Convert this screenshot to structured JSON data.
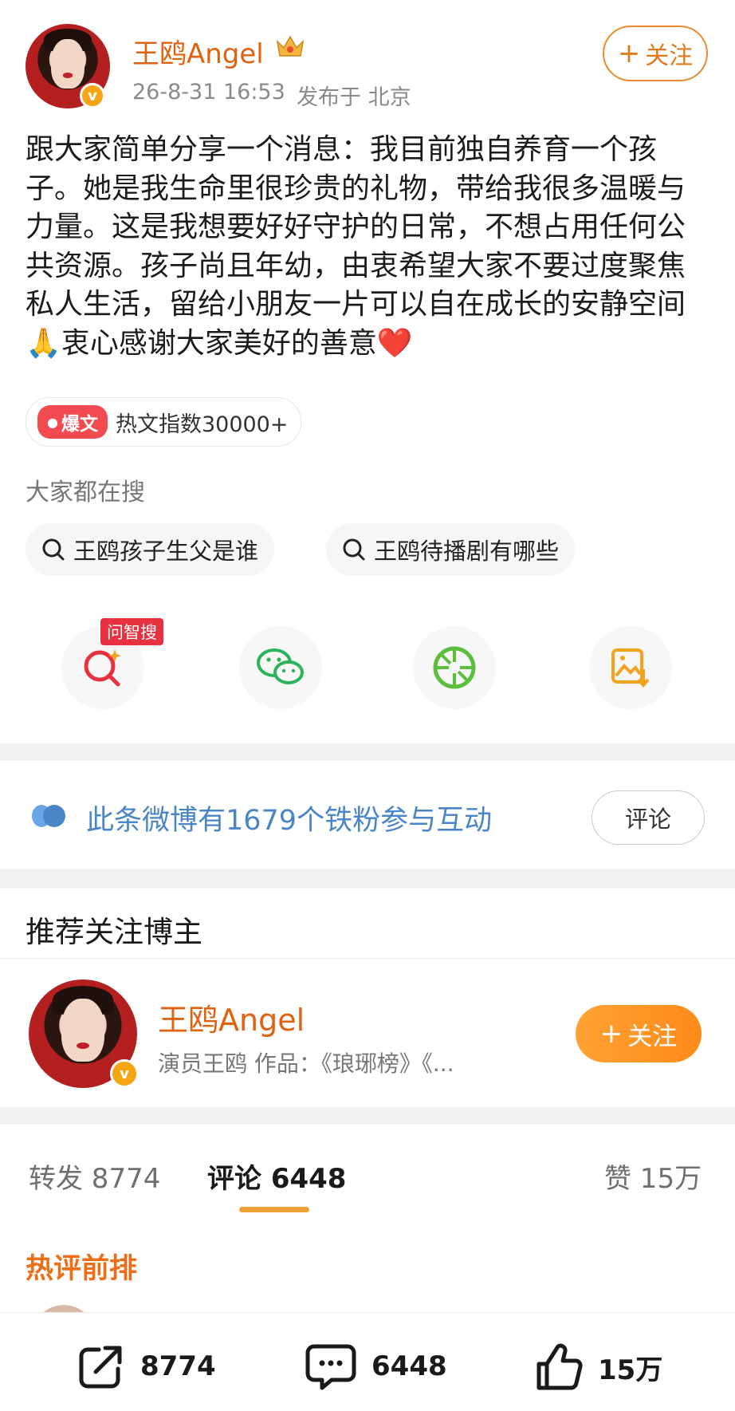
{
  "author": {
    "name": "王鸥Angel",
    "crown_icon": "crown-icon",
    "verified_icon": "verified-v-icon",
    "verified_mark": "v",
    "timestamp": "26-8-31 16:53",
    "location": "发布于 北京"
  },
  "header": {
    "follow_label": "关注",
    "follow_plus": "+"
  },
  "post": {
    "text": "跟大家简单分享一个消息：我目前独自养育一个孩子。她是我生命里很珍贵的礼物，带给我很多温暖与力量。这是我想要好好守护的日常，不想占用任何公共资源。孩子尚且年幼，由衷希望大家不要过度聚焦私人生活，留给小朋友一片可以自在成长的安静空间🙏衷心感谢大家美好的善意❤️"
  },
  "hot": {
    "badge_label": "爆文",
    "index_text": "热文指数30000+"
  },
  "searches": {
    "heading": "大家都在搜",
    "items": [
      {
        "label": "王鸥孩子生父是谁"
      },
      {
        "label": "王鸥待播剧有哪些"
      }
    ]
  },
  "share_actions": {
    "ask_badge": "问智搜",
    "items": [
      {
        "icon": "ai-search-icon"
      },
      {
        "icon": "wechat-icon"
      },
      {
        "icon": "moments-icon"
      },
      {
        "icon": "save-image-icon"
      }
    ]
  },
  "fans": {
    "text": "此条微博有1679个铁粉参与互动",
    "comment_button": "评论"
  },
  "recommend": {
    "heading": "推荐关注博主",
    "name": "王鸥Angel",
    "description": "演员王鸥 作品：《琅琊榜》《...",
    "follow_label": "关注",
    "follow_plus": "+"
  },
  "tabs": {
    "repost": "转发 8774",
    "comment": "评论 6448",
    "like": "赞 15万"
  },
  "hot_comments_heading": "热评前排",
  "bottom_bar": {
    "repost_count": "8774",
    "comment_count": "6448",
    "like_count": "15万"
  },
  "colors": {
    "brand_orange": "#e0620f",
    "link_blue": "#4a86c7",
    "tab_underline": "#f2a13a"
  }
}
